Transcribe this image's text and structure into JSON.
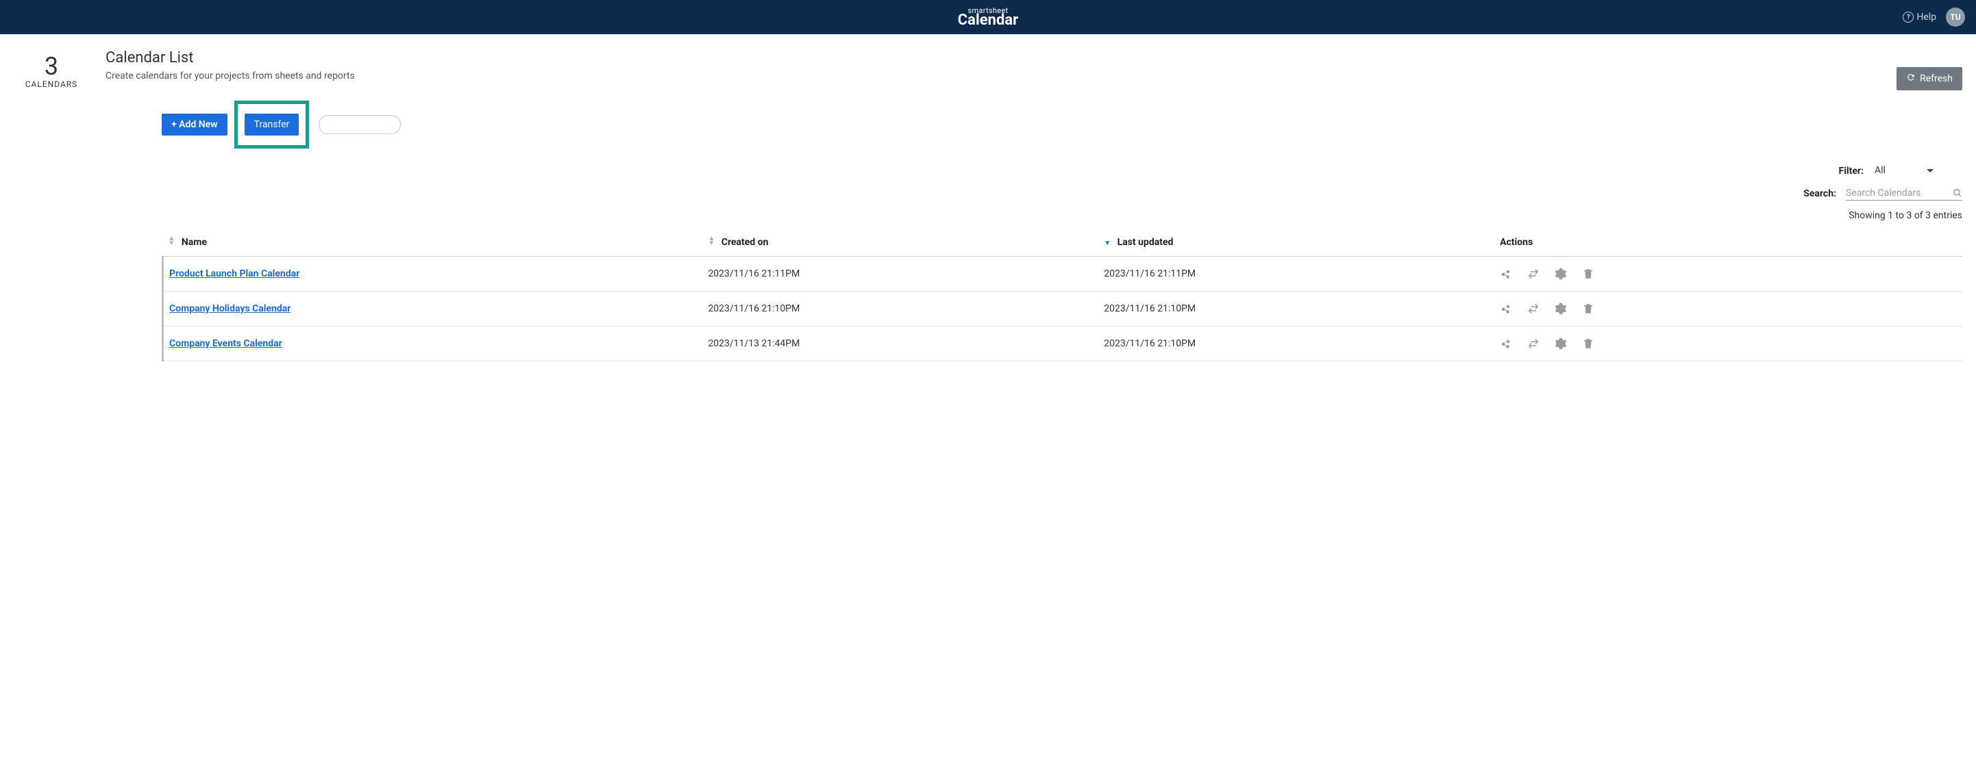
{
  "topbar": {
    "brand_small": "smartsheet",
    "brand_large": "Calendar",
    "help_label": "Help",
    "avatar": "TU"
  },
  "summary": {
    "count": "3",
    "label": "CALENDARS"
  },
  "header": {
    "title": "Calendar List",
    "subtitle": "Create calendars for your projects from sheets and reports"
  },
  "buttons": {
    "refresh": "Refresh",
    "add_new": "+ Add New",
    "transfer": "Transfer"
  },
  "filter": {
    "label": "Filter:",
    "value": "All"
  },
  "search": {
    "label": "Search:",
    "placeholder": "Search Calendars"
  },
  "entries_text": "Showing 1 to 3 of 3 entries",
  "columns": {
    "name": "Name",
    "created": "Created on",
    "updated": "Last updated",
    "actions": "Actions"
  },
  "rows": [
    {
      "name": "Product Launch Plan Calendar",
      "created": "2023/11/16 21:11PM",
      "updated": "2023/11/16 21:11PM"
    },
    {
      "name": "Company Holidays Calendar",
      "created": "2023/11/16 21:10PM",
      "updated": "2023/11/16 21:10PM"
    },
    {
      "name": "Company Events Calendar",
      "created": "2023/11/13 21:44PM",
      "updated": "2023/11/16 21:10PM"
    }
  ]
}
